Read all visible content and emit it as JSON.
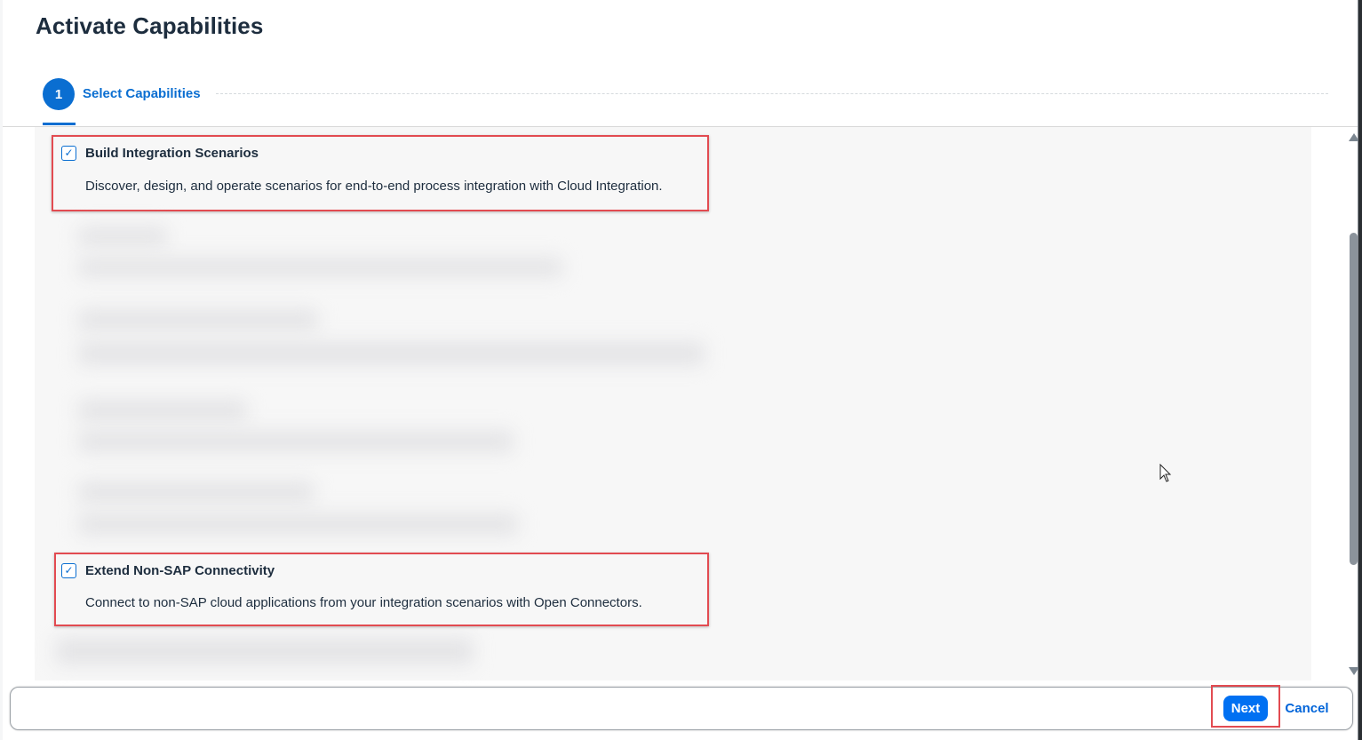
{
  "dialog": {
    "title": "Activate Capabilities"
  },
  "wizard": {
    "steps": [
      {
        "number": "1",
        "label": "Select Capabilities"
      }
    ]
  },
  "capabilities": [
    {
      "title": "Build Integration Scenarios",
      "description": "Discover, design, and operate scenarios for end-to-end process integration with Cloud Integration.",
      "checked": true
    },
    {
      "title": "Extend Non-SAP Connectivity",
      "description": "Connect to non-SAP cloud applications from your integration scenarios with Open Connectors.",
      "checked": true
    }
  ],
  "footer": {
    "next_label": "Next",
    "cancel_label": "Cancel"
  },
  "icons": {
    "checkbox": "checkmark-icon",
    "cursor": "mouse-pointer-icon"
  },
  "colors": {
    "accent": "#0a6ed1",
    "button": "#0070f2",
    "highlight": "#e24b51"
  }
}
